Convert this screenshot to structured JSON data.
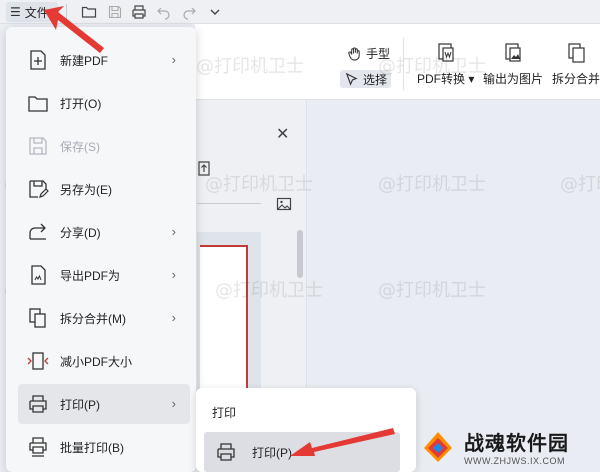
{
  "topbar": {
    "file_label": "文件",
    "menu_glyph": "☰"
  },
  "ribbon": {
    "hand_tool": "手型",
    "select_tool": "选择",
    "pdf_convert": "PDF转换",
    "export_image": "输出为图片",
    "split_merge": "拆分合并"
  },
  "file_menu": {
    "items": [
      {
        "label": "新建PDF",
        "icon": "new-pdf-icon",
        "submenu": true
      },
      {
        "label": "打开(O)",
        "icon": "folder-icon",
        "submenu": false
      },
      {
        "label": "保存(S)",
        "icon": "save-icon",
        "submenu": false,
        "disabled": true
      },
      {
        "label": "另存为(E)",
        "icon": "save-as-icon",
        "submenu": false
      },
      {
        "label": "分享(D)",
        "icon": "share-icon",
        "submenu": true
      },
      {
        "label": "导出PDF为",
        "icon": "export-pdf-icon",
        "submenu": true
      },
      {
        "label": "拆分合并(M)",
        "icon": "split-merge-icon",
        "submenu": true
      },
      {
        "label": "减小PDF大小",
        "icon": "compress-icon",
        "submenu": false
      },
      {
        "label": "打印(P)",
        "icon": "printer-icon",
        "submenu": true,
        "highlighted": true
      },
      {
        "label": "批量打印(B)",
        "icon": "batch-print-icon",
        "submenu": false
      }
    ]
  },
  "submenu": {
    "title": "打印",
    "item": "打印(P)"
  },
  "watermark": "@打印机卫士",
  "logo": {
    "title": "战魂软件园",
    "url": "WWW.ZHJWS.IX.COM"
  },
  "colors": {
    "accent_red": "#e53935",
    "border_red": "#c23b3b"
  }
}
